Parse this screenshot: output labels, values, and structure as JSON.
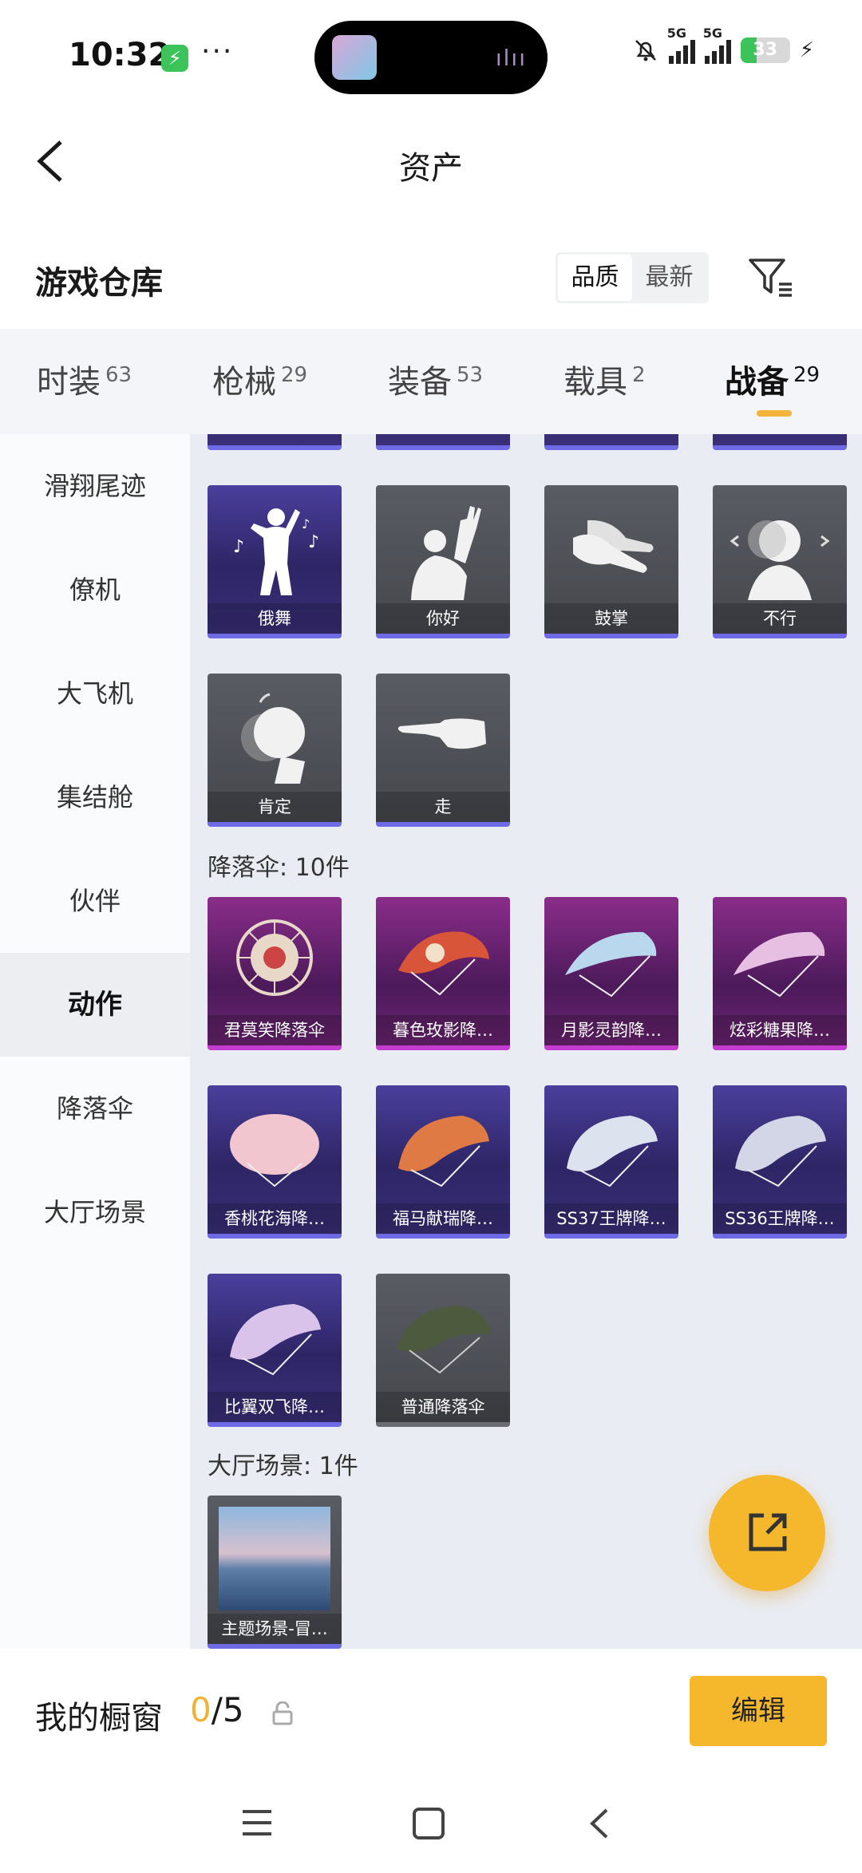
{
  "status_bar": {
    "time": "10:32",
    "dots": "···",
    "signal1": "5G",
    "signal2": "5G",
    "battery_level": 33,
    "battery_text": "33"
  },
  "header": {
    "title": "资产"
  },
  "section": {
    "title": "游戏仓库",
    "sort_options": [
      "品质",
      "最新"
    ],
    "sort_active": "品质"
  },
  "tabs": [
    {
      "label": "时装",
      "count": "63"
    },
    {
      "label": "枪械",
      "count": "29"
    },
    {
      "label": "装备",
      "count": "53"
    },
    {
      "label": "载具",
      "count": "2"
    },
    {
      "label": "战备",
      "count": "29",
      "active": true
    }
  ],
  "sidebar": [
    {
      "label": "滑翔尾迹"
    },
    {
      "label": "僚机"
    },
    {
      "label": "大飞机"
    },
    {
      "label": "集结舱"
    },
    {
      "label": "伙伴"
    },
    {
      "label": "动作",
      "active": true
    },
    {
      "label": "降落伞"
    },
    {
      "label": "大厅场景"
    }
  ],
  "actions": [
    {
      "label": "俄舞",
      "style": "purple",
      "icon": "dancer-icon"
    },
    {
      "label": "你好",
      "style": "gray",
      "icon": "wave-hello-icon"
    },
    {
      "label": "鼓掌",
      "style": "gray",
      "icon": "clapping-hands-icon"
    },
    {
      "label": "不行",
      "style": "gray",
      "icon": "head-shake-icon"
    },
    {
      "label": "肯定",
      "style": "gray",
      "icon": "head-nod-icon"
    },
    {
      "label": "走",
      "style": "gray",
      "icon": "pointing-hand-icon"
    }
  ],
  "parachute_group": {
    "label": "降落伞: 10件"
  },
  "parachutes": [
    {
      "label": "君莫笑降落伞",
      "style": "magenta",
      "color": "#e8d8c8"
    },
    {
      "label": "暮色玫影降…",
      "style": "magenta",
      "color": "#d8553a"
    },
    {
      "label": "月影灵韵降…",
      "style": "magenta",
      "color": "#b9d8ee"
    },
    {
      "label": "炫彩糖果降…",
      "style": "magenta",
      "color": "#e7bfe2"
    },
    {
      "label": "香桃花海降…",
      "style": "purple",
      "color": "#f2c6cf"
    },
    {
      "label": "福马献瑞降…",
      "style": "purple",
      "color": "#e07a44"
    },
    {
      "label": "SS37王牌降…",
      "style": "purple",
      "color": "#dde3ee"
    },
    {
      "label": "SS36王牌降…",
      "style": "purple",
      "color": "#d2d6e6"
    },
    {
      "label": "比翼双飞降…",
      "style": "purple",
      "color": "#d9c3ea"
    },
    {
      "label": "普通降落伞",
      "style": "gray-p",
      "color": "#4e5a3e"
    }
  ],
  "lobby_group": {
    "label": "大厅场景: 1件"
  },
  "lobby_scenes": [
    {
      "label": "主题场景-冒…",
      "style": "gray"
    }
  ],
  "footer": {
    "showcase_label": "我的橱窗",
    "count_current": "0",
    "count_total": "/5",
    "edit_label": "编辑"
  }
}
